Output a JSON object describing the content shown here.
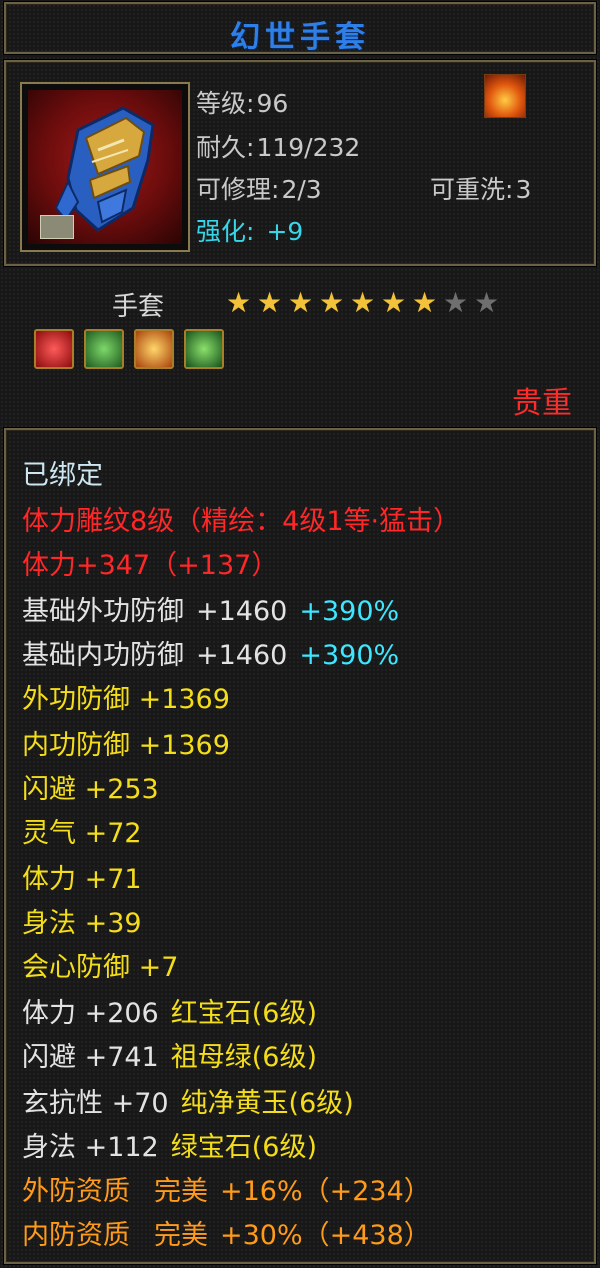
{
  "title": "幻世手套",
  "info": {
    "level_label": "等级:",
    "level_value": "96",
    "durability_label": "耐久:",
    "durability_value": "119/232",
    "repair_label": "可修理:",
    "repair_value": "2/3",
    "rewash_label": "可重洗:",
    "rewash_value": "3",
    "enhance_label": "强化:",
    "enhance_value": "+9"
  },
  "item_type": "手套",
  "stars": {
    "filled": 7,
    "total": 9
  },
  "gems": [
    {
      "icon": "red-gem-icon",
      "color": "#d42020"
    },
    {
      "icon": "green-gem-icon",
      "color": "#3aa33a"
    },
    {
      "icon": "orange-gem-icon",
      "color": "#e88a1a"
    },
    {
      "icon": "emerald-gem-icon",
      "color": "#2f8f2f"
    }
  ],
  "rarity": "贵重",
  "stats": {
    "bound": "已绑定",
    "engraving": "体力雕纹8级（精绘：4级1等·猛击）",
    "stamina_bonus": "体力+347（+137）",
    "base_ext_def": {
      "label": "基础外功防御",
      "value": "+1460",
      "pct": "+390%"
    },
    "base_int_def": {
      "label": "基础内功防御",
      "value": "+1460",
      "pct": "+390%"
    },
    "ext_def": "外功防御 +1369",
    "int_def": "内功防御 +1369",
    "dodge": "闪避 +253",
    "spirit": "灵气 +72",
    "stamina": "体力 +71",
    "agility": "身法 +39",
    "crit_def": "会心防御 +7",
    "gem_stats": [
      {
        "stat": "体力 +206",
        "gem": "红宝石(6级)"
      },
      {
        "stat": "闪避 +741",
        "gem": "祖母绿(6级)"
      },
      {
        "stat": "玄抗性 +70",
        "gem": "纯净黄玉(6级)"
      },
      {
        "stat": "身法 +112",
        "gem": "绿宝石(6级)"
      }
    ],
    "ext_quality": {
      "label": "外防资质",
      "grade": "完美",
      "value": "+16%（+234）"
    },
    "int_quality": {
      "label": "内防资质",
      "grade": "完美",
      "value": "+30%（+438）"
    }
  },
  "colors": {
    "title": "#2f7fe8",
    "rarity": "#ff2a2a",
    "engraving": "#ff2727",
    "percent": "#3ee6ff",
    "gem_text": "#f4dd1a",
    "quality": "#ff9a1a"
  }
}
